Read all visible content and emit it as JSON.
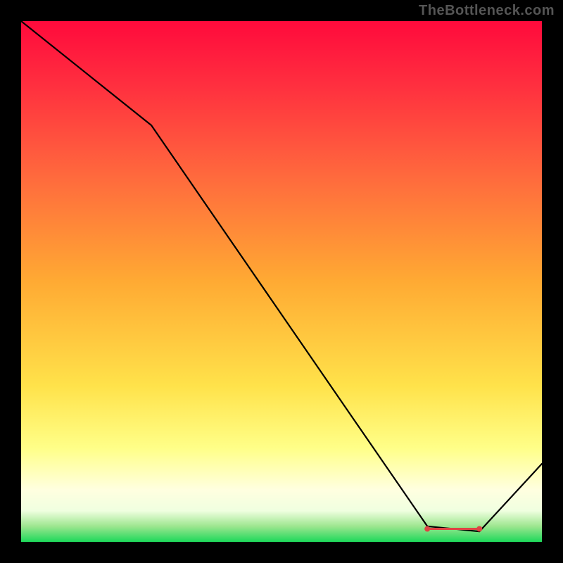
{
  "watermark": "TheBottleneck.com",
  "colors": {
    "band_fill": "#d44",
    "curve_stroke": "#000000",
    "background": "#000000"
  },
  "chart_data": {
    "type": "line",
    "title": "",
    "xlabel": "",
    "ylabel": "",
    "xlim": [
      0,
      100
    ],
    "ylim": [
      0,
      100
    ],
    "series": [
      {
        "name": "curve",
        "x": [
          0,
          25,
          78,
          88,
          100
        ],
        "values": [
          100,
          80,
          3,
          2,
          15
        ]
      }
    ],
    "optimal_band": {
      "x_start": 78,
      "x_end": 88,
      "y": 2.5
    }
  }
}
